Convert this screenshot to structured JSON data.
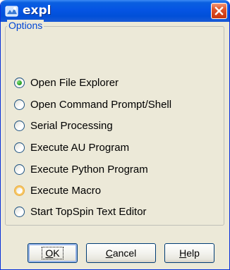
{
  "window": {
    "title": "expl",
    "icon": "topspin-app-icon",
    "close_icon": "close-icon"
  },
  "options": {
    "legend": "Options",
    "selected_index": 0,
    "hover_index": 5,
    "items": [
      {
        "label": "Open File Explorer"
      },
      {
        "label": "Open Command Prompt/Shell"
      },
      {
        "label": "Serial Processing"
      },
      {
        "label": "Execute AU Program"
      },
      {
        "label": "Execute Python Program"
      },
      {
        "label": "Execute Macro"
      },
      {
        "label": "Start TopSpin Text Editor"
      }
    ]
  },
  "buttons": {
    "ok": {
      "mnemonic": "O",
      "rest": "K"
    },
    "cancel": {
      "mnemonic": "C",
      "rest": "ancel"
    },
    "help": {
      "mnemonic": "H",
      "rest": "elp"
    }
  },
  "colors": {
    "titlebar": "#0554e3",
    "legend_text": "#0046d5",
    "radio_selected": "#2fa52c",
    "radio_hover": "#f8c760"
  }
}
